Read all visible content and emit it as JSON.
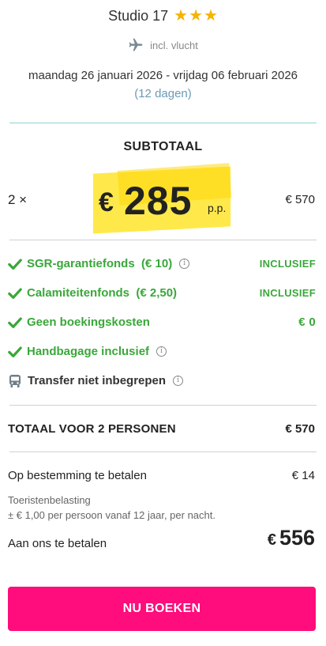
{
  "header": {
    "hotel_name": "Studio 17",
    "star_count": 3,
    "flight_label": "incl. vlucht",
    "dates": "maandag 26 januari 2026 - vrijdag 06 februari 2026",
    "duration": "(12 dagen)"
  },
  "subtotal": {
    "title": "SUBTOTAAL",
    "quantity": "2 ×",
    "currency": "€",
    "price_per_person": "285",
    "per_person_label": "p.p.",
    "line_total": "€ 570"
  },
  "features": [
    {
      "label": "SGR-garantiefonds  (€ 10)",
      "status": "INCLUSIEF",
      "icon": "check-icon",
      "has_info": true
    },
    {
      "label": "Calamiteitenfonds  (€ 2,50)",
      "status": "INCLUSIEF",
      "icon": "check-icon",
      "has_info": false
    },
    {
      "label": "Geen boekingskosten",
      "status": "€ 0",
      "icon": "check-icon",
      "has_info": false
    },
    {
      "label": "Handbagage inclusief",
      "status": "",
      "icon": "check-icon",
      "has_info": true
    },
    {
      "label": "Transfer niet inbegrepen",
      "status": "",
      "icon": "bus-icon",
      "has_info": true
    }
  ],
  "total": {
    "label": "TOTAAL VOOR 2 PERSONEN",
    "value": "€ 570"
  },
  "destination_payment": {
    "label": "Op bestemming te betalen",
    "value": "€ 14",
    "tax_title": "Toeristenbelasting",
    "tax_description": "± € 1,00 per persoon vanaf 12 jaar, per nacht."
  },
  "final": {
    "label": "Aan ons te betalen",
    "currency": "€",
    "value": "556"
  },
  "book_button": "NU BOEKEN",
  "colors": {
    "star": "#f5b400",
    "green": "#3aa73a",
    "highlight": "#ffe94a",
    "button": "#ff0c7d",
    "link": "#6a9bb5"
  }
}
